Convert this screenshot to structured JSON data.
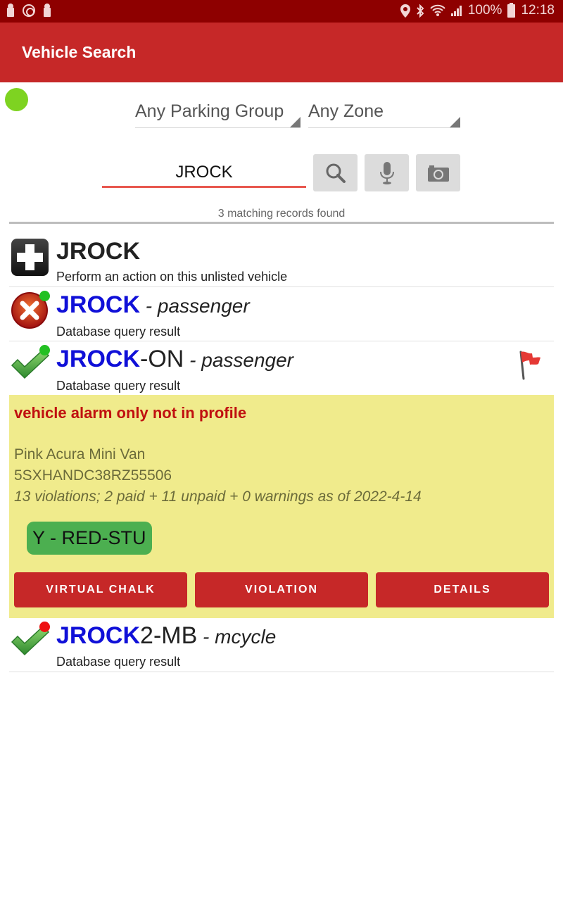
{
  "status_bar": {
    "left_icons": [
      "keyhole-icon",
      "power-icon",
      "keyhole-icon"
    ],
    "right_icons": [
      "location-icon",
      "bluetooth-icon",
      "wifi-icon",
      "signal-icon"
    ],
    "battery": "100%",
    "time": "12:18"
  },
  "app_bar": {
    "title": "Vehicle Search"
  },
  "connection_status": {
    "color": "#7ed321",
    "state": "connected"
  },
  "filters": {
    "parking_group": "Any Parking Group",
    "zone": "Any Zone"
  },
  "search": {
    "value": "JROCK",
    "buttons": [
      "search-icon",
      "microphone-icon",
      "camera-icon"
    ]
  },
  "results_summary": "3 matching records found",
  "results": [
    {
      "icon": "add-icon",
      "plate": "JROCK",
      "subtitle": "Perform an action on this unlisted vehicle"
    },
    {
      "icon": "error-icon",
      "status_dot": "#22c022",
      "plate_match": "JROCK",
      "plate_rest": "",
      "type": " - passenger",
      "subtitle": "Database query result"
    },
    {
      "icon": "check-icon",
      "status_dot": "#22c022",
      "plate_match": "JROCK",
      "plate_rest": "-ON",
      "type": " - passenger",
      "subtitle": "Database query result",
      "flag": "flag-icon",
      "details": {
        "alarm": "vehicle alarm only not in profile",
        "description": "Pink Acura Mini Van",
        "vin": "5SXHANDC38RZ55506",
        "violations": "13 violations; 2 paid + 11 unpaid + 0 warnings as of 2022-4-14",
        "permit": "Y - RED-STU",
        "actions": {
          "virtual_chalk": "VIRTUAL CHALK",
          "violation": "VIOLATION",
          "details": "DETAILS"
        }
      }
    },
    {
      "icon": "check-icon",
      "status_dot": "#ee1111",
      "plate_match": "JROCK",
      "plate_rest": "2-MB",
      "type": " - mcycle",
      "subtitle": "Database query result"
    }
  ]
}
